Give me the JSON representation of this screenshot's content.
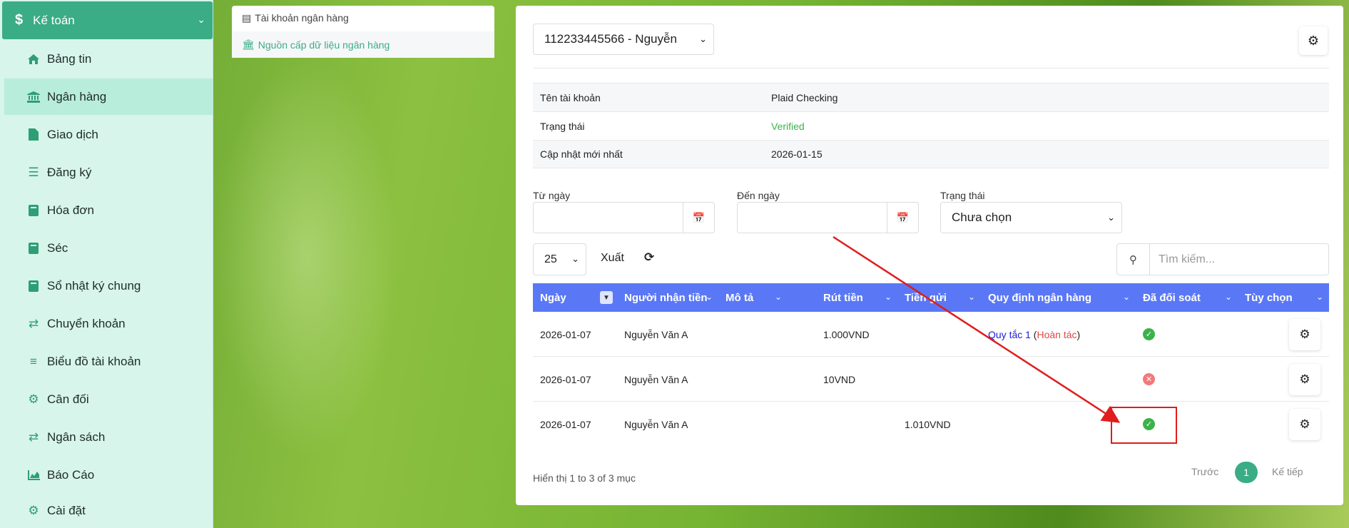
{
  "sidebar": {
    "header": {
      "label": "Kế toán",
      "icon": "dollar-icon"
    },
    "items": [
      {
        "label": "Bảng tin",
        "icon": "home-icon"
      },
      {
        "label": "Ngân hàng",
        "icon": "bank-icon",
        "active": true
      },
      {
        "label": "Giao dịch",
        "icon": "file-icon"
      },
      {
        "label": "Đăng ký",
        "icon": "list-icon"
      },
      {
        "label": "Hóa đơn",
        "icon": "book-icon"
      },
      {
        "label": "Séc",
        "icon": "book-icon"
      },
      {
        "label": "Sổ nhật ký chung",
        "icon": "book-icon"
      },
      {
        "label": "Chuyển khoản",
        "icon": "exchange-icon"
      },
      {
        "label": "Biểu đồ tài khoản",
        "icon": "ordered-list-icon"
      },
      {
        "label": "Cân đối",
        "icon": "sliders-icon"
      },
      {
        "label": "Ngân sách",
        "icon": "exchange-icon"
      },
      {
        "label": "Báo Cáo",
        "icon": "area-chart-icon"
      },
      {
        "label": "Cài đặt",
        "icon": "gear-icon"
      }
    ]
  },
  "tabs": {
    "bank_accounts": "Tài khoản ngân hàng",
    "bank_feeds": "Nguồn cấp dữ liệu ngân hàng"
  },
  "account_select": {
    "value": "112233445566 - Nguyễn"
  },
  "account_info": [
    {
      "key": "Tên tài khoản",
      "value": "Plaid Checking"
    },
    {
      "key": "Trạng thái",
      "value": "Verified"
    },
    {
      "key": "Cập nhật mới nhất",
      "value": "2026-01-15"
    }
  ],
  "filters": {
    "from_label": "Từ ngày",
    "to_label": "Đến ngày",
    "status_label": "Trạng thái",
    "status_value": "Chưa chọn"
  },
  "toolbar": {
    "page_length": "25",
    "export_label": "Xuất",
    "search_placeholder": "Tìm kiếm..."
  },
  "table": {
    "headers": [
      "Ngày",
      "Người nhận tiền",
      "Mô tả",
      "Rút tiền",
      "Tiền gửi",
      "Quy định ngân hàng",
      "Đã đối soát",
      "Tùy chọn"
    ],
    "rows": [
      {
        "date": "2026-01-07",
        "payee": "Nguyễn Văn A",
        "description": "",
        "withdrawal": "1.000VND",
        "deposit": "",
        "rule": "Quy tắc 1",
        "undo": "Hoàn tác",
        "reconciled": true
      },
      {
        "date": "2026-01-07",
        "payee": "Nguyễn Văn A",
        "description": "",
        "withdrawal": "10VND",
        "deposit": "",
        "rule": "",
        "undo": "",
        "reconciled": false
      },
      {
        "date": "2026-01-07",
        "payee": "Nguyễn Văn A",
        "description": "",
        "withdrawal": "",
        "deposit": "1.010VND",
        "rule": "",
        "undo": "",
        "reconciled": true
      }
    ]
  },
  "footer": {
    "showing": "Hiển thị 1 to 3 of 3 mục",
    "prev": "Trước",
    "page": "1",
    "next": "Kế tiếp"
  },
  "colors": {
    "accent": "#3aac86",
    "table_header": "#5a78f5",
    "annotation": "#e01c1c"
  }
}
